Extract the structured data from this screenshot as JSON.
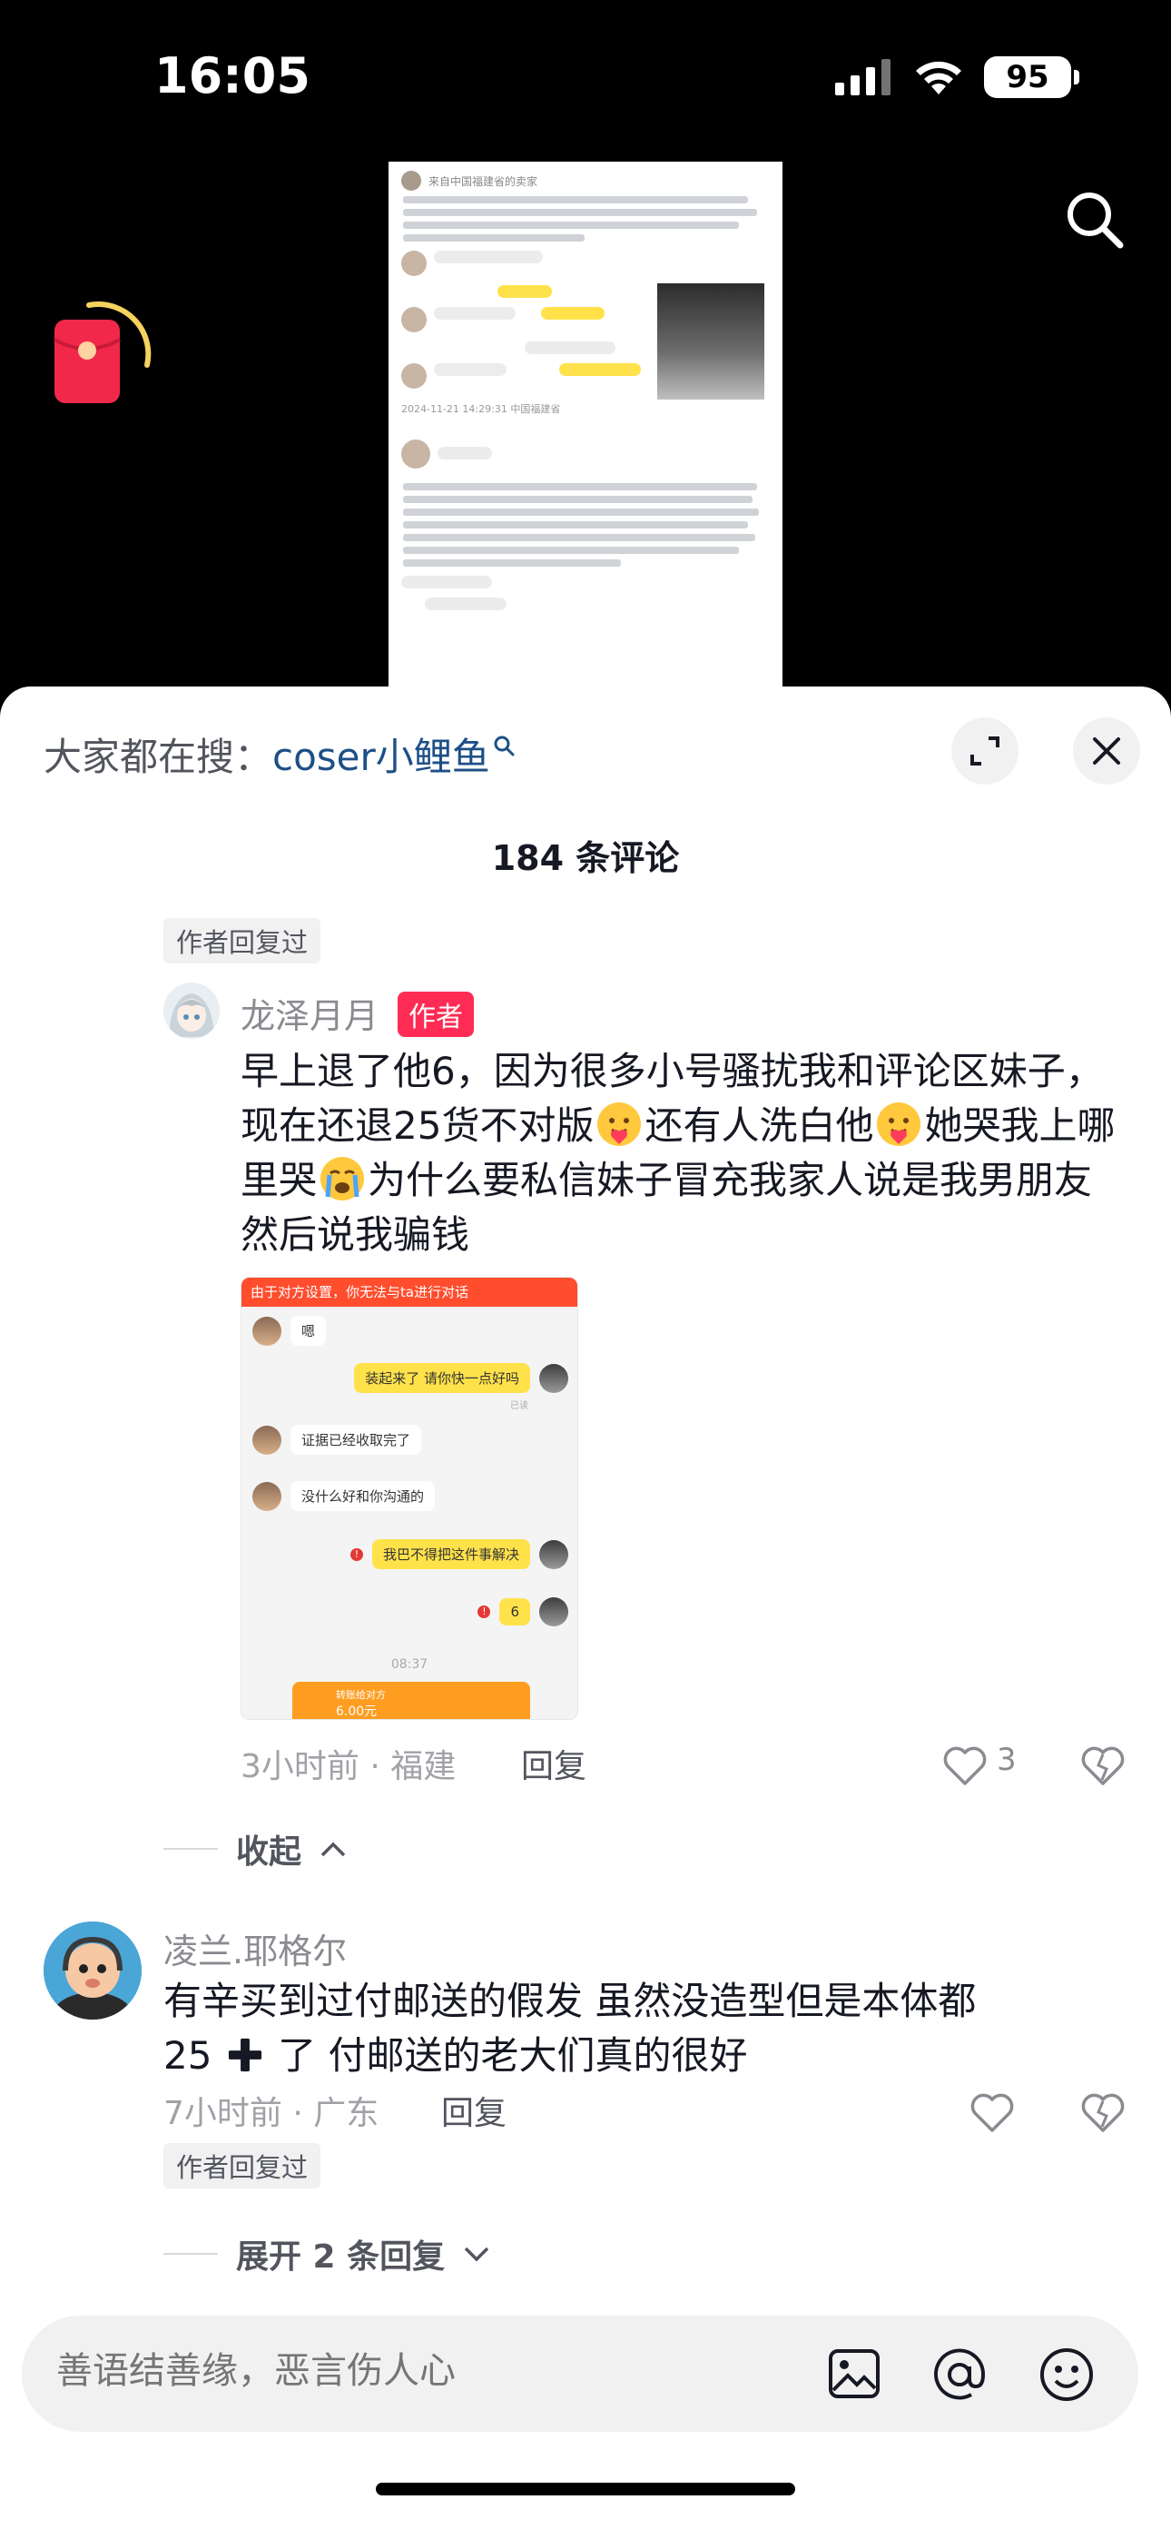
{
  "status_bar": {
    "time": "16:05",
    "battery": "95"
  },
  "video": {
    "preview_header": "来自中国福建省的卖家",
    "preview_footer_time": "2024-11-21 14:29:31  中国福建省"
  },
  "sheet": {
    "hot_search_label": "大家都在搜：",
    "hot_search_keyword": "coser小鲤鱼",
    "comment_count": "184 条评论"
  },
  "comments": {
    "top_author_replied": "作者回复过",
    "reply": {
      "username": "龙泽月月",
      "badge": "作者",
      "text_part1": "早上退了他6，因为很多小号骚扰我和评论区妹子，现在还退25货不对版",
      "text_part2": "还有人洗白他",
      "text_part3": "她哭我上哪里哭",
      "text_part4": "为什么要私信妹子冒充我家人说是我男朋友然后说我骗钱",
      "image": {
        "banner": "由于对方设置，你无法与ta进行对话",
        "msg1": "嗯",
        "msg2": "装起来了 请你快一点好吗",
        "msg2_status": "已读",
        "msg3": "证据已经收取完了",
        "msg4": "没什么好和你沟通的",
        "msg5": "我巴不得把这件事解决",
        "msg6": "6",
        "time": "08:37",
        "transfer_title": "转账给对方",
        "transfer_amount": "6.00元"
      },
      "time_loc": "3小时前 · 福建",
      "reply_label": "回复",
      "likes": "3"
    },
    "collapse_label": "收起",
    "comment2": {
      "username": "凌兰.耶格尔",
      "text_line1": "有辛买到过付邮送的假发 虽然没造型但是本体都",
      "text_line2a": "25",
      "text_line2b": "了 付邮送的老大们真的很好",
      "time_loc": "7小时前 · 广东",
      "reply_label": "回复",
      "author_replied": "作者回复过"
    },
    "expand_label": "展开 2 条回复"
  },
  "input": {
    "placeholder": "善语结善缘，恶言伤人心"
  }
}
